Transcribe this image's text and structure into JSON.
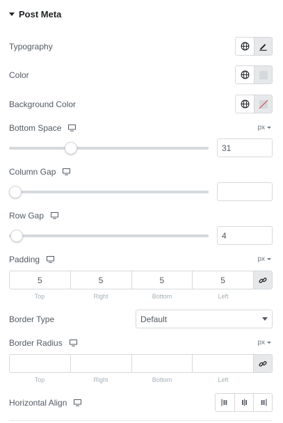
{
  "section": {
    "title": "Post Meta"
  },
  "typography": {
    "label": "Typography",
    "globe_icon": "globe-icon",
    "edit_icon": "pencil-icon"
  },
  "color": {
    "label": "Color",
    "swatch_color": "#d5d8dc"
  },
  "background_color": {
    "label": "Background Color",
    "swatch": "none"
  },
  "bottom_space": {
    "label": "Bottom Space",
    "unit": "px",
    "value": "31",
    "slider_fraction": 0.31
  },
  "column_gap": {
    "label": "Column Gap",
    "value": "",
    "slider_fraction": 0
  },
  "row_gap": {
    "label": "Row Gap",
    "value": "4",
    "slider_fraction": 0.04
  },
  "padding": {
    "label": "Padding",
    "unit": "px",
    "values": [
      "5",
      "5",
      "5",
      "5"
    ],
    "sides": [
      "Top",
      "Right",
      "Bottom",
      "Left"
    ]
  },
  "border_type": {
    "label": "Border Type",
    "selected": "Default"
  },
  "border_radius": {
    "label": "Border Radius",
    "unit": "px",
    "values": [
      "",
      "",
      "",
      ""
    ],
    "sides": [
      "Top",
      "Right",
      "Bottom",
      "Left"
    ]
  },
  "horizontal_align": {
    "label": "Horizontal Align",
    "options": [
      "align-left-icon",
      "align-center-icon",
      "align-right-icon"
    ]
  }
}
